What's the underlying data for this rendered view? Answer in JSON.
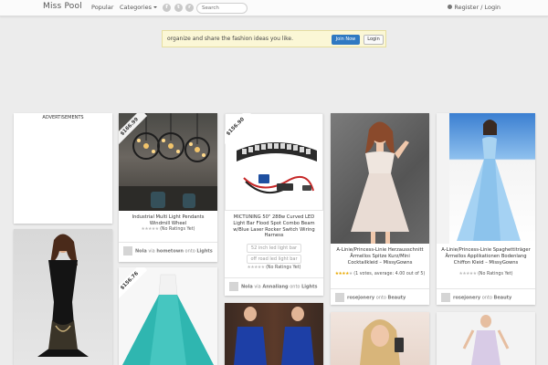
{
  "nav": {
    "brand": "Miss Pool",
    "popular": "Popular",
    "categories": "Categories",
    "search_placeholder": "Search",
    "register_login": "Register / Login",
    "social": [
      "f",
      "t",
      "r"
    ]
  },
  "promo": {
    "text": "organize and share the fashion ideas you like.",
    "join_label": "Join Now",
    "login_label": "Login"
  },
  "ad": {
    "label": "ADVERTISEMENTS"
  },
  "pins": [
    {
      "price": "$166.99",
      "caption": "Industrial Multi Light Pendants Windmill Wheel",
      "rating_text": "(No Ratings Yet)",
      "user": "Nola",
      "board_prefix": "via",
      "source": "hometown",
      "board_join": "onto",
      "board": "Lights"
    },
    {
      "price": "$156.90",
      "caption": "MICTUNING 50\" 288w Curved LED Light Bar Flood Spot Combo Beam w/Blue Laser Rocker Switch Wiring Harness",
      "tags": [
        "52 inch led light bar",
        "off road led light bar"
      ],
      "rating_text": "(No Ratings Yet)",
      "user": "Nola",
      "board_prefix": "via",
      "source": "Annaliang",
      "board_join": "onto",
      "board": "Lights"
    },
    {
      "caption": "A-Linie/Princess-Linie Herzausschnitt Ärmellos Spitze Kurz/Mini Cocktailkleid – MissyGowns",
      "rating_text": "(1 votes, average: 4.00 out of 5)",
      "user": "rosejonery",
      "board_join": "onto",
      "board": "Beauty"
    },
    {
      "caption": "A-Linie/Princess-Linie Spaghettiträger Ärmellos Applikationen Bodenlang Chiffon Kleid – MissyGowns",
      "rating_text": "(No Ratings Yet)",
      "user": "rosejonery",
      "board_join": "onto",
      "board": "Beauty"
    },
    {
      "price": "$156.76"
    }
  ],
  "colors": {
    "accent": "#2f79c2",
    "promo_bg": "#fbf7d6",
    "page_bg": "#ececec"
  }
}
